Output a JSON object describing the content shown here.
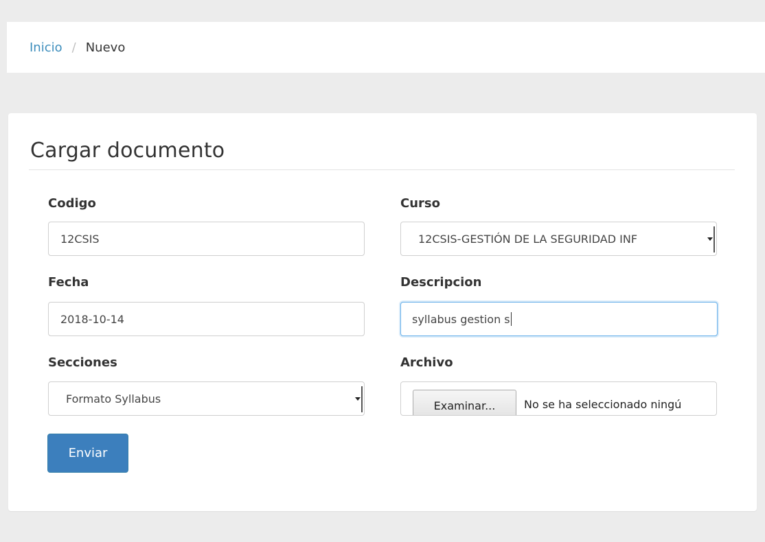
{
  "breadcrumb": {
    "home": "Inicio",
    "separator": "/",
    "current": "Nuevo"
  },
  "form": {
    "title": "Cargar documento",
    "codigo": {
      "label": "Codigo",
      "value": "12CSIS"
    },
    "curso": {
      "label": "Curso",
      "value": "12CSIS-GESTIÓN DE LA SEGURIDAD INF"
    },
    "fecha": {
      "label": "Fecha",
      "value": "2018-10-14"
    },
    "descripcion": {
      "label": "Descripcion",
      "value": "syllabus gestion s"
    },
    "secciones": {
      "label": "Secciones",
      "value": "Formato Syllabus"
    },
    "archivo": {
      "label": "Archivo",
      "button_label": "Examinar...",
      "status": "No se ha seleccionado ningú"
    },
    "submit_label": "Enviar"
  },
  "colors": {
    "link": "#3c8dbc",
    "primary_button": "#3c7fbd",
    "focus_border": "#66afe9",
    "page_background": "#ececec"
  }
}
